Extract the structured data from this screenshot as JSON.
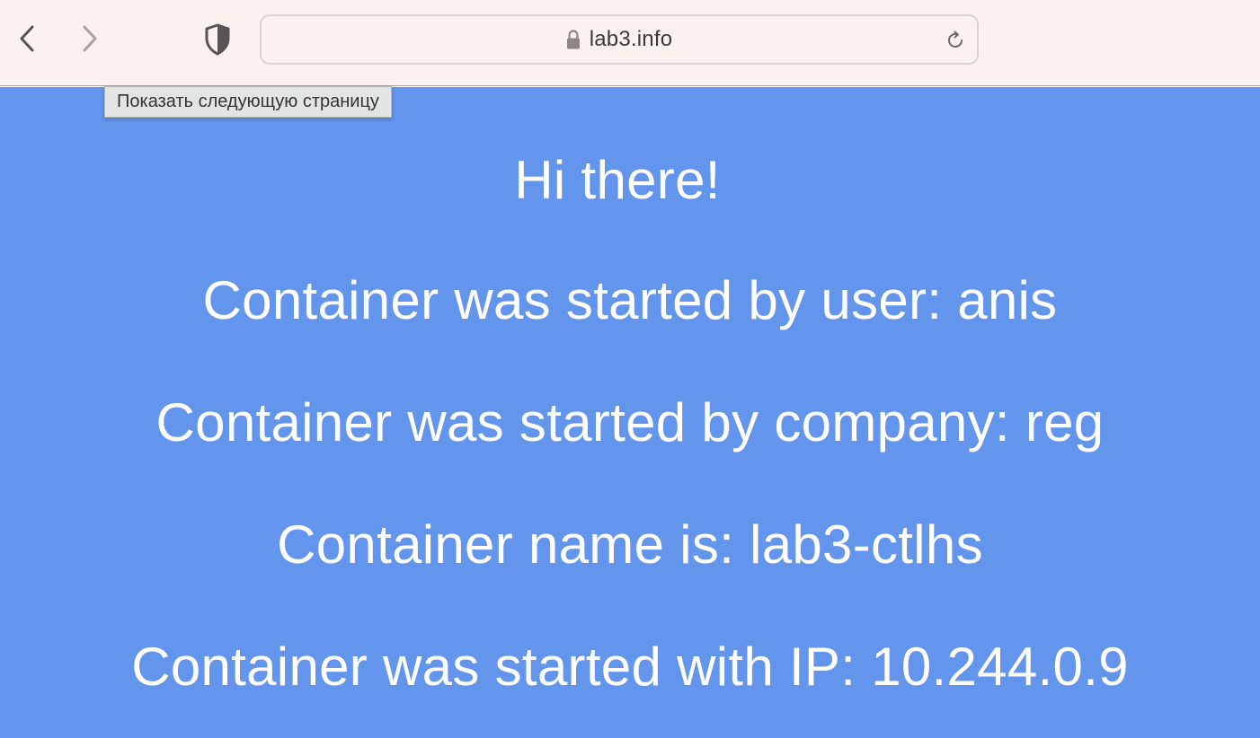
{
  "browser": {
    "url": "lab3.info",
    "tooltip": "Показать следующую страницу",
    "icons": {
      "back": "chevron-left-icon",
      "forward": "chevron-right-icon",
      "privacy": "shield-icon",
      "lock": "lock-icon",
      "reload": "reload-icon"
    }
  },
  "page": {
    "background": "#6495ed",
    "text_color": "#ffffff",
    "greeting": "Hi there!",
    "lines": [
      "Container was started by user: anis",
      "Container was started by company: reg",
      "Container name is: lab3-ctlhs",
      "Container was started with IP: 10.244.0.9"
    ]
  }
}
